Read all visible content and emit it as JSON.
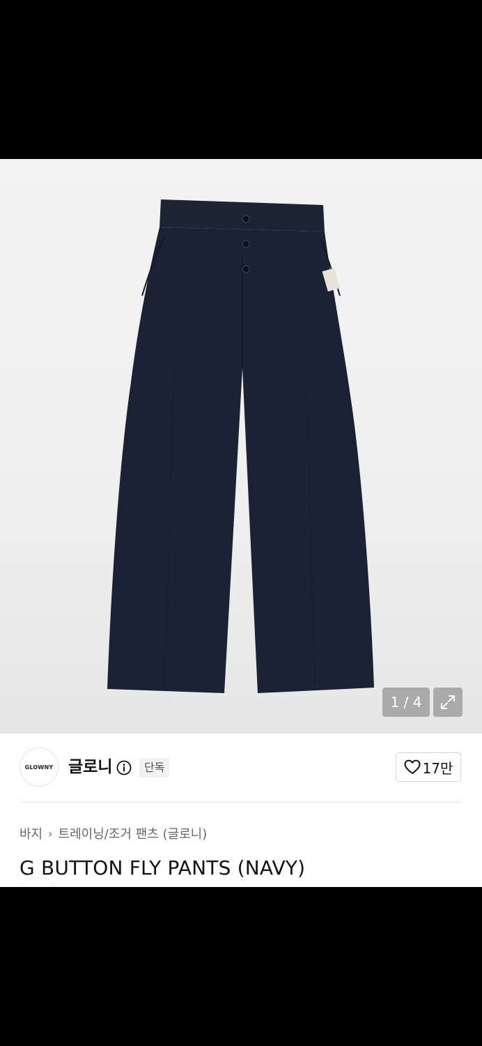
{
  "gallery": {
    "image_alt": "navy wide pants",
    "counter": "1 / 4"
  },
  "brand": {
    "logo_text": "GLOWNY",
    "name": "글로니",
    "badge": "단독"
  },
  "like": {
    "count": "17만"
  },
  "breadcrumb": {
    "level1": "바지",
    "level2": "트레이닝/조거 팬츠 (글로니)"
  },
  "product": {
    "title": "G BUTTON FLY PANTS (NAVY)"
  },
  "colors": {
    "pants": "#1b2233",
    "accent": "#111111"
  }
}
